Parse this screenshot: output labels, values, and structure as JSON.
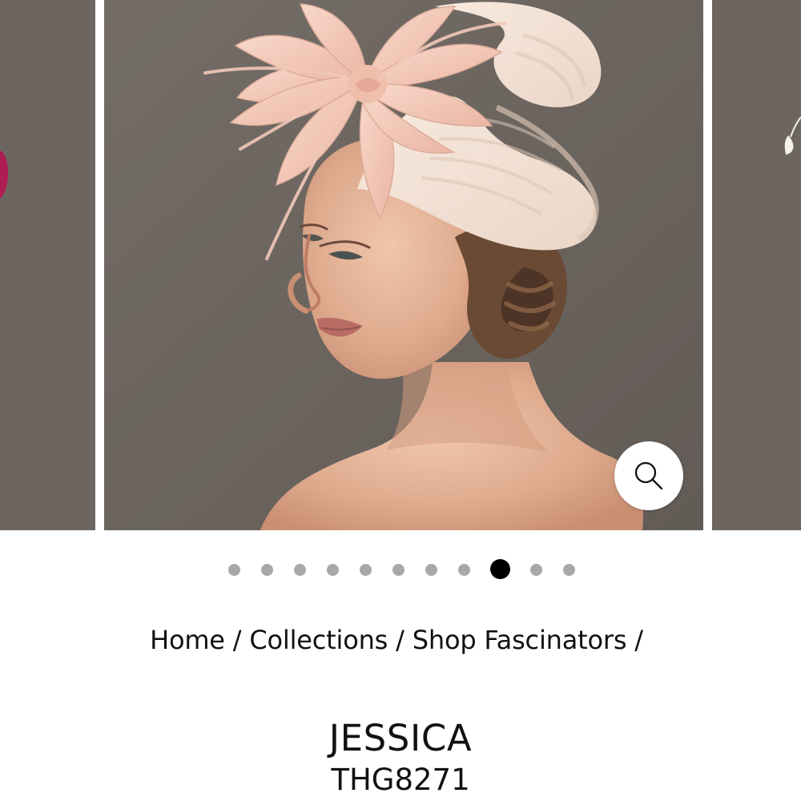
{
  "breadcrumb": {
    "items": [
      "Home",
      "Collections",
      "Shop Fascinators"
    ],
    "separator": "/"
  },
  "product": {
    "name": "JESSICA",
    "sku": "THG8271"
  },
  "gallery": {
    "dot_count": 11,
    "active_dot_index": 8,
    "colors": {
      "background": "#6d6660",
      "hat": "#f2dfd1",
      "feather": "#f1c8b8",
      "skin": "#e7b99f",
      "hair": "#6a4a34",
      "accent_left": "#b01d52",
      "active_dot": "#000000",
      "inactive_dot": "#a8a8a8"
    }
  },
  "icons": {
    "zoom": "search-icon"
  }
}
